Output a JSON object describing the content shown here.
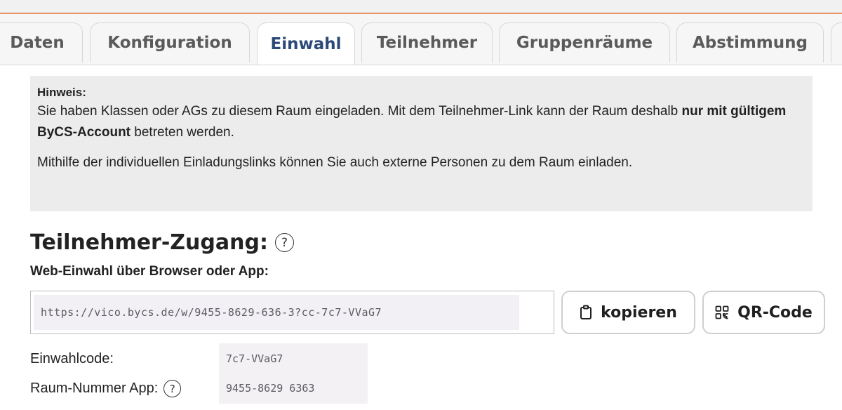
{
  "tabs": [
    {
      "label": "Daten",
      "active": false
    },
    {
      "label": "Konfiguration",
      "active": false
    },
    {
      "label": "Einwahl",
      "active": true
    },
    {
      "label": "Teilnehmer",
      "active": false
    },
    {
      "label": "Gruppenräume",
      "active": false
    },
    {
      "label": "Abstimmung",
      "active": false
    }
  ],
  "notice": {
    "title": "Hinweis:",
    "line1_before": "Sie haben Klassen oder AGs zu diesem Raum eingeladen. Mit dem Teilnehmer-Link kann der Raum deshalb ",
    "line1_bold": "nur mit gültigem ByCS-Account",
    "line1_after": " betreten werden.",
    "line2": "Mithilfe der individuellen Einladungslinks können Sie auch externe Personen zu dem Raum einladen."
  },
  "section": {
    "title": "Teilnehmer-Zugang:",
    "help_symbol": "?",
    "web_label": "Web-Einwahl über Browser oder App:",
    "url_value": "https://vico.bycs.de/w/9455-8629-636-3?cc-7c7-VVaG7"
  },
  "buttons": {
    "copy_label": "kopieren",
    "copy_icon": "clipboard-icon",
    "qr_label": "QR-Code",
    "qr_icon": "qr-code-icon"
  },
  "details": {
    "dial_code_label": "Einwahlcode:",
    "dial_code_value": "7c7-VVaG7",
    "room_number_label": "Raum-Nummer App:",
    "room_number_value": "9455-8629 6363",
    "help_symbol": "?"
  },
  "colors": {
    "active_tab_text": "#2b4a78",
    "accent_line": "#e8946a",
    "notice_bg": "#ececec"
  }
}
